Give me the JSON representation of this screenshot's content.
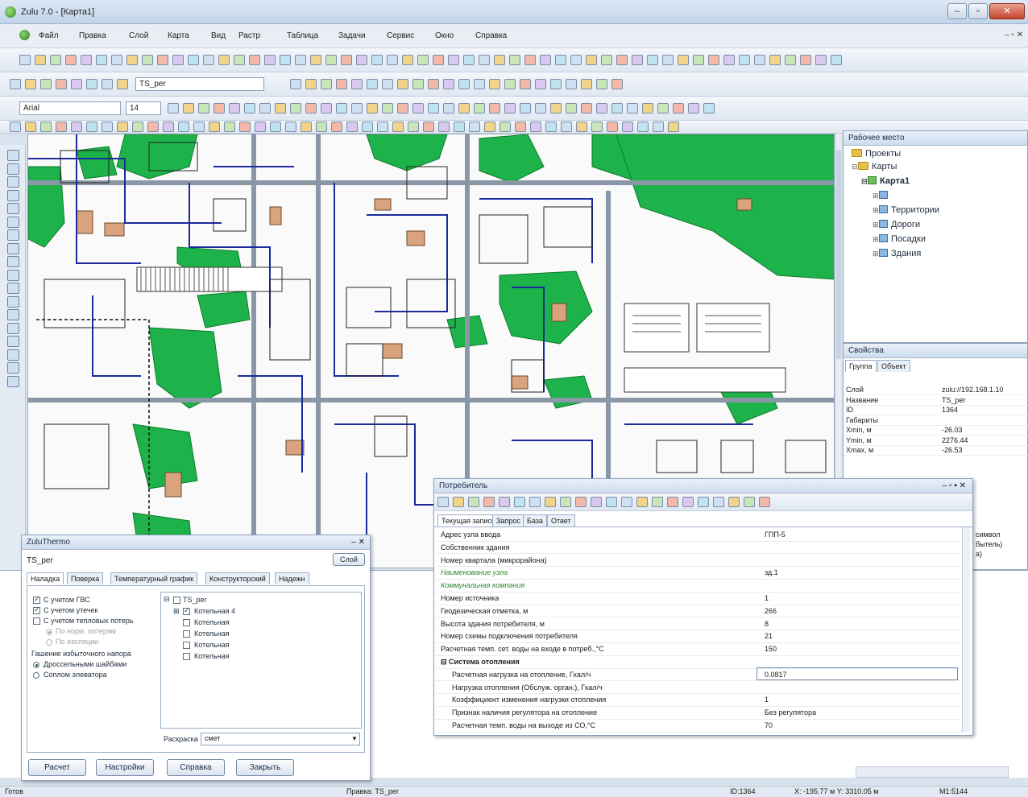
{
  "window": {
    "title": "Zulu 7.0 - [Карта1]",
    "min": "–",
    "max": "▫",
    "close": "✕"
  },
  "menu": {
    "items": [
      "Файл",
      "Правка",
      "Слой",
      "Карта",
      "Вид",
      "Растр",
      "Таблица",
      "Задачи",
      "Сервис",
      "Окно",
      "Справка"
    ],
    "child_controls": "– ▫ ✕"
  },
  "toolbar2": {
    "layer_name": "TS_per"
  },
  "toolbar3": {
    "font": "Arial",
    "font_size": "14"
  },
  "workspace": {
    "title": "Рабочее место",
    "tree": {
      "projects": "Проекты",
      "maps": "Карты",
      "map1": "Карта1",
      "layers": [
        "Территории",
        "Дороги",
        "Посадки",
        "Здания"
      ]
    }
  },
  "properties": {
    "title": "Свойства",
    "tabs": [
      "Группа",
      "Объект"
    ],
    "rows": [
      {
        "k": "Слой",
        "v": "zulu://192.168.1.10"
      },
      {
        "k": "Название",
        "v": "TS_per"
      },
      {
        "k": "ID",
        "v": "1364"
      },
      {
        "k": "Габариты",
        "v": ""
      },
      {
        "k": "Xmin, м",
        "v": "-26.03"
      },
      {
        "k": "Ymin, м",
        "v": "2276.44"
      },
      {
        "k": "Xmax, м",
        "v": "-26.53"
      }
    ],
    "clipped_1": "символ",
    "clipped_2": "бытель)",
    "clipped_3": "а)"
  },
  "consumer": {
    "title": "Потребитель",
    "controls": "– ▫ ▪ ✕",
    "tabs": [
      "Текущая запись",
      "Запрос",
      "База",
      "Ответ"
    ],
    "rows": [
      {
        "k": "Адрес узла ввода",
        "v": "ГПП-5",
        "type": "normal"
      },
      {
        "k": "Собственник здания",
        "v": "",
        "type": "normal"
      },
      {
        "k": "Номер квартала (микрорайона)",
        "v": "",
        "type": "normal"
      },
      {
        "k": "Наименование узла",
        "v": "зд.1",
        "type": "green"
      },
      {
        "k": "Коммунальная компания",
        "v": "",
        "type": "green"
      },
      {
        "k": "Номер источника",
        "v": "1",
        "type": "normal"
      },
      {
        "k": "Геодезическая отметка, м",
        "v": "266",
        "type": "normal"
      },
      {
        "k": "Высота здания потребителя, м",
        "v": "8",
        "type": "normal"
      },
      {
        "k": "Номер схемы подключения потребителя",
        "v": "21",
        "type": "normal"
      },
      {
        "k": "Расчетная темп. сет. воды на входе в потреб.,°С",
        "v": "150",
        "type": "normal"
      },
      {
        "k": "⊟  Система отопления",
        "v": "",
        "type": "section"
      },
      {
        "k": "Расчетная нагрузка на отопление, Гкал/ч",
        "v": "0.0817",
        "type": "ind"
      },
      {
        "k": "Нагрузка отопления (Обслуж. орган.), Гкал/ч",
        "v": "",
        "type": "ind"
      },
      {
        "k": "Коэффициент изменения нагрузки отопления",
        "v": "1",
        "type": "ind"
      },
      {
        "k": "Признак наличия регулятора на отопление",
        "v": "Без регулятора",
        "type": "ind"
      },
      {
        "k": "Расчетная темп. воды на выходе из СО,°С",
        "v": "70",
        "type": "ind"
      }
    ]
  },
  "zulutherm": {
    "title": "ZuluThermo",
    "layer": "TS_per",
    "layer_btn": "Слой",
    "tabs": [
      "Наладка",
      "Поверка",
      "Температурный график",
      "Конструкторский",
      "Надежн"
    ],
    "opts": {
      "gvs": "С учетом ГВС",
      "leaks": "С учетом утечек",
      "heat_loss": "С учетом тепловых потерь",
      "norm_loss": "По норм. потерям",
      "insulation": "По изоляции",
      "excess_head": "Гашение избыточного напора",
      "throttle": "Дроссельными шайбами",
      "elevator": "Соплом элеватора"
    },
    "tree": {
      "root": "TS_per",
      "items": [
        "Котельная 4",
        "Котельная",
        "Котельная",
        "Котельная",
        "Котельная"
      ]
    },
    "color_label": "Раскраска",
    "color_value": "смет",
    "buttons": {
      "calc": "Расчет",
      "settings": "Настройки",
      "help": "Справка",
      "close": "Закрыть"
    }
  },
  "status": {
    "ready": "Готов",
    "edit": "Правка: TS_per",
    "id": "ID:1364",
    "coords": "X: -195.77 м  Y: 3310.05 м",
    "scale": "M1:5144"
  },
  "colors": {
    "vegetation": "#1db34a",
    "building": "#d9a37d",
    "road": "#8a97a6",
    "pipe": "#1c2a9e"
  }
}
